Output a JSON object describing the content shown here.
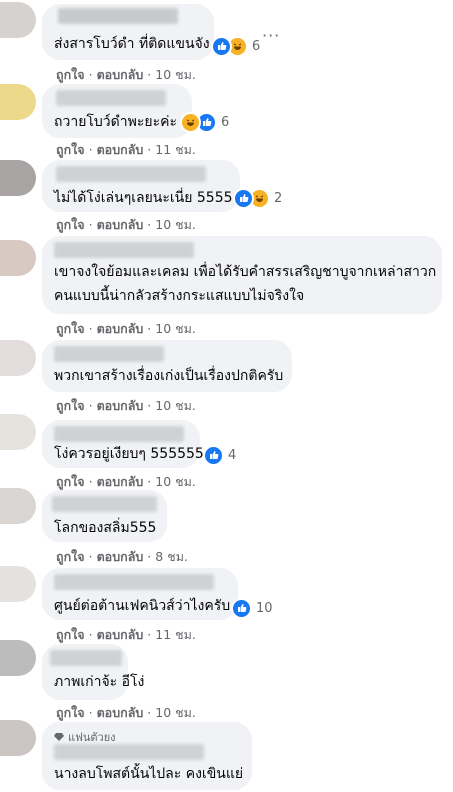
{
  "action_like": "ถูกใจ",
  "action_reply": "ตอบกลับ",
  "separator": "·",
  "more_label": "···",
  "fan_badge": "แฟนตัวยง",
  "colors": {
    "like": "#1877f2",
    "haha": "#f7b125",
    "bubble": "#f0f2f5",
    "secondary": "#65676b"
  },
  "comments": [
    {
      "text": "ส่งสารโบว์ดำ ที่ติดแขนจัง",
      "time": "10 ชม.",
      "reactions": [
        "like-icon",
        "haha-icon"
      ],
      "reaction_count": "6"
    },
    {
      "text": "ถวายโบว์ดำพะยะค่ะ",
      "time": "11 ชม.",
      "reactions": [
        "haha-icon",
        "like-icon"
      ],
      "reaction_count": "6"
    },
    {
      "text": "ไม่ได้โง่เล่นๆเลยนะเนี่ย 5555",
      "time": "10 ชม.",
      "reactions": [
        "like-icon",
        "haha-icon"
      ],
      "reaction_count": "2"
    },
    {
      "text_lines": [
        "เขาจงใจย้อมและเคลม เพื่อได้รับคำสรรเสริญชาบูจากเหล่าสาวก",
        "คนแบบนี้น่ากลัวสร้างกระแสแบบไม่จริงใจ"
      ],
      "time": "10 ชม."
    },
    {
      "text": "พวกเขาสร้างเรื่องเก่งเป็นเรื่องปกติครับ",
      "time": "10 ชม."
    },
    {
      "text": "โง่ควรอยู่เงียบๆ 555555",
      "time": "10 ชม.",
      "reactions": [
        "like-icon"
      ],
      "reaction_count": "4"
    },
    {
      "text": "โลกของสลิ่ม555",
      "time": "8 ชม."
    },
    {
      "text": "ศูนย์ต่อต้านเฟคนิวส์ว่าไงครับ",
      "time": "11 ชม.",
      "reactions": [
        "like-icon"
      ],
      "reaction_count": "10"
    },
    {
      "text": "ภาพเก่าจ้ะ อีโง่",
      "time": "10 ชม."
    },
    {
      "text": "นางลบโพสต์นั้นไปละ คงเขินแย่"
    }
  ]
}
